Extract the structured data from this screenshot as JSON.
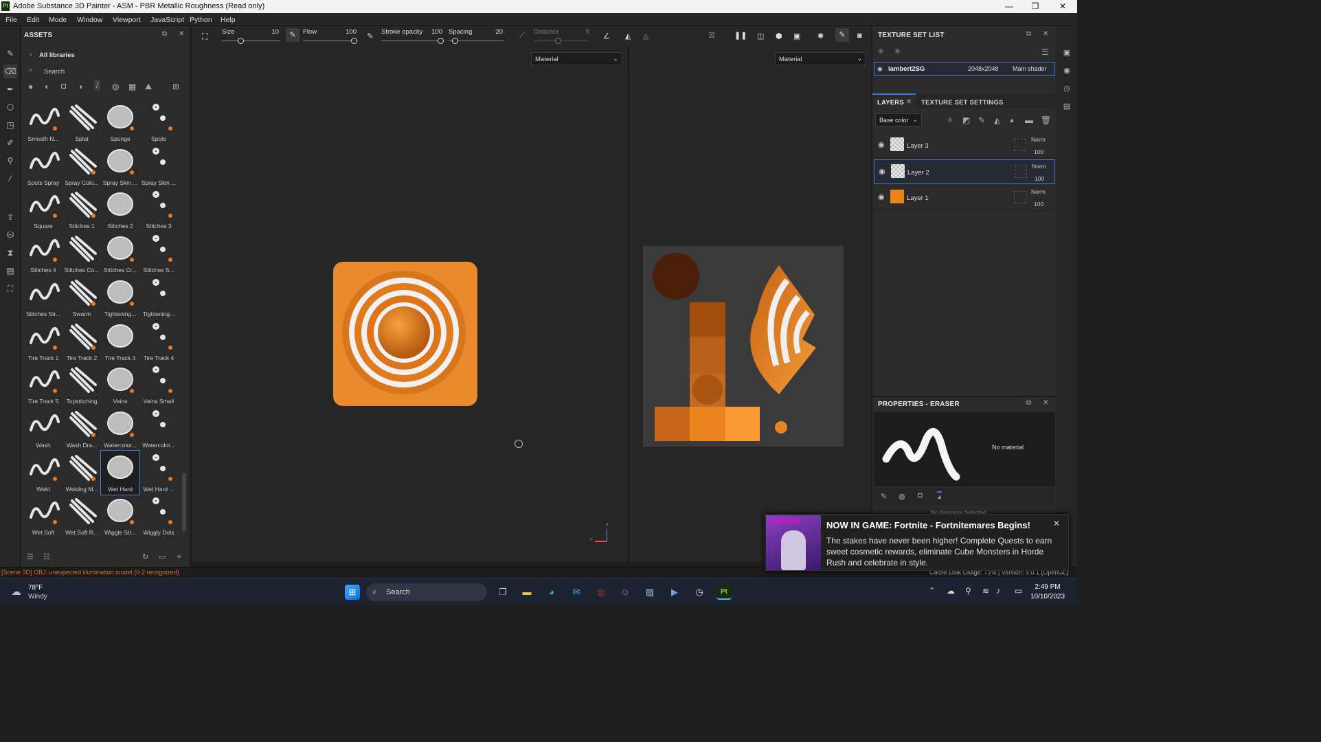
{
  "app": {
    "logo": "Pt",
    "title": "Adobe Substance 3D Painter - ASM - PBR Metallic Roughness (Read only)"
  },
  "menu": [
    "File",
    "Edit",
    "Mode",
    "Window",
    "Viewport",
    "JavaScript",
    "Python",
    "Help"
  ],
  "assets": {
    "title": "ASSETS",
    "library": "All libraries",
    "search_placeholder": "Search",
    "items": [
      {
        "label": "Smooth N..."
      },
      {
        "label": "Splat"
      },
      {
        "label": "Sponge"
      },
      {
        "label": "Spots"
      },
      {
        "label": "Spots Spray"
      },
      {
        "label": "Spray Colo..."
      },
      {
        "label": "Spray Skin ..."
      },
      {
        "label": "Spray Skin ..."
      },
      {
        "label": "Square"
      },
      {
        "label": "Stitches 1"
      },
      {
        "label": "Stitches 2"
      },
      {
        "label": "Stitches 3"
      },
      {
        "label": "Stitches 4"
      },
      {
        "label": "Stitches Co..."
      },
      {
        "label": "Stitches Cr..."
      },
      {
        "label": "Stitches S..."
      },
      {
        "label": "Stitches Str..."
      },
      {
        "label": "Swarm"
      },
      {
        "label": "Tightening..."
      },
      {
        "label": "Tightening..."
      },
      {
        "label": "Tire Track 1"
      },
      {
        "label": "Tire Track 2"
      },
      {
        "label": "Tire Track 3"
      },
      {
        "label": "Tire Track 4"
      },
      {
        "label": "Tire Track 5"
      },
      {
        "label": "Topstitching"
      },
      {
        "label": "Veins"
      },
      {
        "label": "Veins Small"
      },
      {
        "label": "Wash"
      },
      {
        "label": "Wash Dra..."
      },
      {
        "label": "Watercolor..."
      },
      {
        "label": "Watercolor..."
      },
      {
        "label": "Weld"
      },
      {
        "label": "Welding M..."
      },
      {
        "label": "Wet Hard"
      },
      {
        "label": "Wet Hard ..."
      },
      {
        "label": "Wet Soft"
      },
      {
        "label": "Wet Soft R..."
      },
      {
        "label": "Wiggle Str..."
      },
      {
        "label": "Wiggly Dots"
      }
    ],
    "selected": "Wet Hard"
  },
  "toolbar": {
    "size_label": "Size",
    "size_value": "10",
    "flow_label": "Flow",
    "flow_value": "100",
    "stroke_label": "Stroke opacity",
    "stroke_value": "100",
    "spacing_label": "Spacing",
    "spacing_value": "20",
    "distance_label": "Distance",
    "distance_value": "8"
  },
  "viewport": {
    "left_mode": "Material",
    "right_mode": "Material",
    "axis_z": "z",
    "axis_x": "x"
  },
  "texture_set_list": {
    "title": "TEXTURE SET LIST",
    "name": "lambert2SG",
    "resolution": "2048x2048",
    "shader": "Main shader"
  },
  "layers": {
    "tab_layers": "LAYERS",
    "tab_settings": "TEXTURE SET SETTINGS",
    "channel": "Base color",
    "items": [
      {
        "name": "Layer 3",
        "blend": "Norm",
        "opacity": "100"
      },
      {
        "name": "Layer 2",
        "blend": "Norm",
        "opacity": "100"
      },
      {
        "name": "Layer 1",
        "blend": "Norm",
        "opacity": "100"
      }
    ]
  },
  "properties": {
    "title": "PROPERTIES - ERASER",
    "material": "No material",
    "resource": "No Resource Selected"
  },
  "status": {
    "error": "[Scene 3D] OBJ: unexpected illumination model (0-2 recognized)",
    "cache": "Cache Disk Usage:   71% | Version: 9.0.1 (OpenGL)"
  },
  "notification": {
    "badge": "FORTNITE",
    "title": "NOW IN GAME: Fortnite - Fortnitemares Begins!",
    "body": "The stakes have never been higher! Complete Quests to earn sweet cosmetic rewards, eliminate Cube Monsters in Horde Rush and celebrate in style."
  },
  "taskbar": {
    "temp": "78°F",
    "weather": "Windy",
    "search": "Search",
    "time": "2:49 PM",
    "date": "10/10/2023"
  },
  "colors": {
    "accent": "#4b7cd6",
    "orange": "#e87b21",
    "panel": "#2b2b2b"
  }
}
